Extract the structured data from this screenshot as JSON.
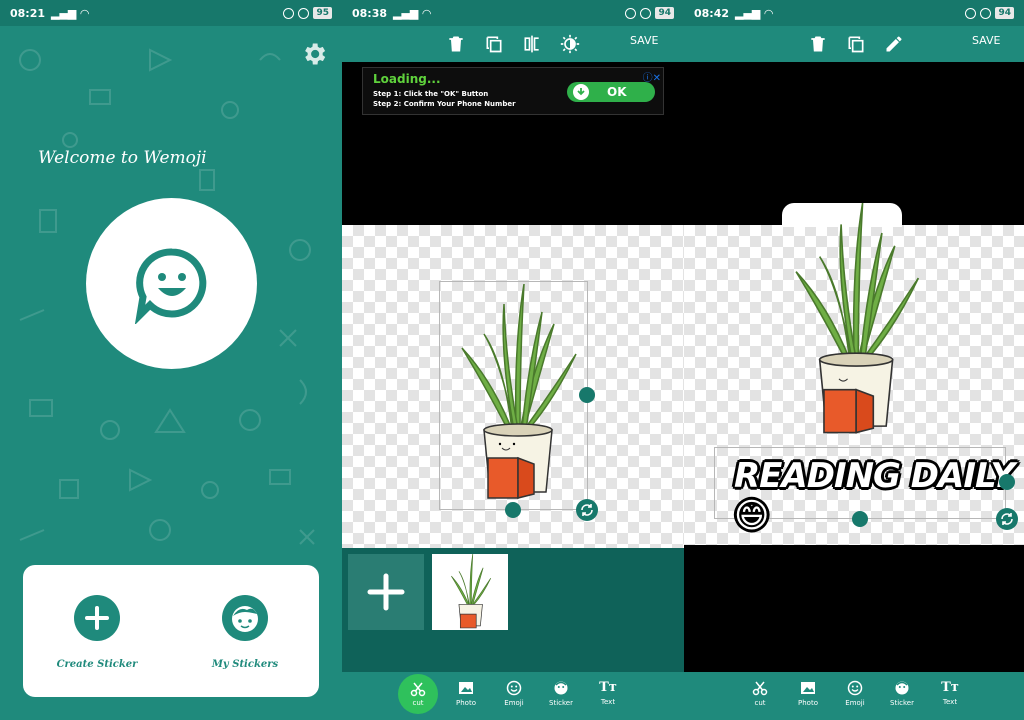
{
  "screen1": {
    "status": {
      "time": "08:21",
      "battery": "95"
    },
    "welcome": "Welcome to Wemoji",
    "create_label": "Create Sticker",
    "my_label": "My Stickers"
  },
  "screen2": {
    "status": {
      "time": "08:38",
      "battery": "94"
    },
    "save": "SAVE",
    "ad": {
      "title": "Loading...",
      "step1": "Step 1: Click the \"OK\" Button",
      "step2": "Step 2: Confirm Your Phone Number",
      "ok": "OK"
    },
    "bottom": {
      "cut": "cut",
      "photo": "Photo",
      "emoji": "Emoji",
      "sticker": "Sticker",
      "text": "Text"
    }
  },
  "screen3": {
    "status": {
      "time": "08:42",
      "battery": "94"
    },
    "save": "SAVE",
    "sticker_text": "READING DAILY😄",
    "bottom": {
      "cut": "cut",
      "photo": "Photo",
      "emoji": "Emoji",
      "sticker": "Sticker",
      "text": "Text"
    }
  },
  "colors": {
    "primary": "#1f8a7c",
    "dark": "#17786b",
    "accent_green": "#2fc15c",
    "ad_green": "#5fd23c"
  }
}
